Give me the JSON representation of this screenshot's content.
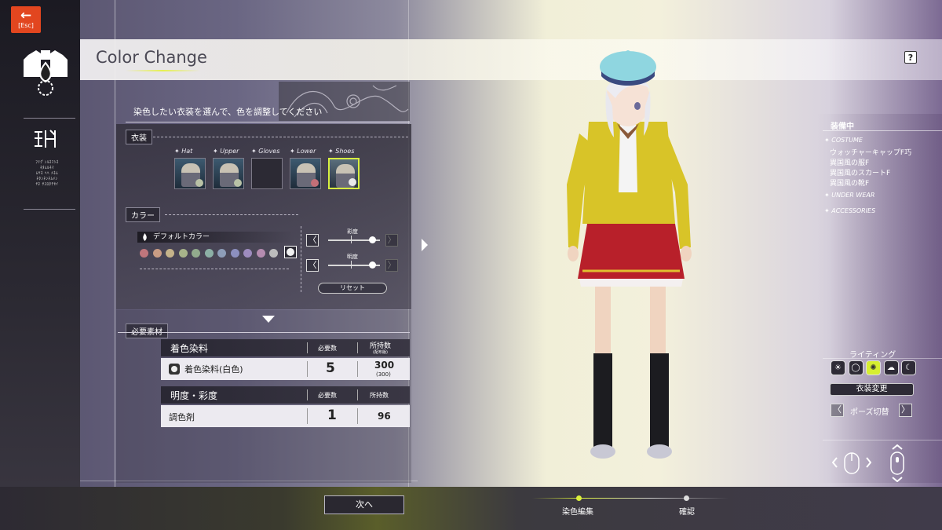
{
  "window": {
    "back_label": "[Esc]",
    "title": "Color Change",
    "help": "?"
  },
  "sidebar": {
    "brand_text": "ﾌﾘｸﾞﾝﾙﾈﾏｼﾈ\nﾈﾀﾑﾙﾈﾏ\nﾑﾔﾈ ﾍﾍ ﾒﾈﾑ\nﾈﾀﾝﾈﾝﾈﾑﾒﾝ\nﾔﾈ ｻｽﾛﾀﾁｾｲ"
  },
  "instruction": "染色したい衣装を選んで、色を調整してください",
  "costume": {
    "label": "衣装",
    "slots": [
      {
        "name": "Hat",
        "filled": true,
        "dot": "#b9c2a6"
      },
      {
        "name": "Upper",
        "filled": true,
        "dot": "#b9c2a6"
      },
      {
        "name": "Gloves",
        "filled": false,
        "dot": ""
      },
      {
        "name": "Lower",
        "filled": true,
        "dot": "#c26f77"
      },
      {
        "name": "Shoes",
        "filled": true,
        "dot": "#e8e8e8",
        "selected": true
      }
    ]
  },
  "color": {
    "label": "カラー",
    "default": "デフォルトカラー",
    "swatches": [
      "#c0767c",
      "#c99c84",
      "#c5b38a",
      "#a7b38a",
      "#92ab8d",
      "#8cb0a6",
      "#8d9db8",
      "#8c8fbf",
      "#9e8cbf",
      "#b58cb0",
      "#bcbcbc"
    ],
    "saturation_label": "彩度",
    "brightness_label": "明度",
    "saturation": 0.85,
    "brightness": 0.85,
    "reset": "リセット"
  },
  "materials": {
    "label": "必要素材",
    "tables": [
      {
        "title": "着色染料",
        "col1": "必要数",
        "col2": "所持数",
        "col2_sub": "(配布版)",
        "row": {
          "name": "着色染料(白色)",
          "need": "5",
          "have": "300",
          "have_sub": "(300)"
        }
      },
      {
        "title": "明度・彩度",
        "col1": "必要数",
        "col2": "所持数",
        "row": {
          "name": "調色剤",
          "need": "1",
          "have": "96"
        }
      }
    ]
  },
  "equipped": {
    "title": "装備中",
    "costume_cat": "COSTUME",
    "items": [
      "ウォッチャーキャップF巧",
      "異国風の服F",
      "異国風のスカートF",
      "異国風の靴F"
    ],
    "underwear_cat": "UNDER WEAR",
    "accessories_cat": "ACCESSORIES"
  },
  "lighting": {
    "label": "ライティング",
    "selected": 2,
    "icons": [
      "☀",
      "◯",
      "✺",
      "☁",
      "☾"
    ]
  },
  "buttons": {
    "change_costume": "衣装変更",
    "pose_switch": "ポーズ切替",
    "next": "次へ"
  },
  "steps": [
    "染色編集",
    "確認"
  ],
  "colors": {
    "accent": "#d8f040",
    "esc": "#e2461f",
    "jacket": "#d8c428",
    "skirt": "#b8202a",
    "hat": "#8fd6e0"
  }
}
